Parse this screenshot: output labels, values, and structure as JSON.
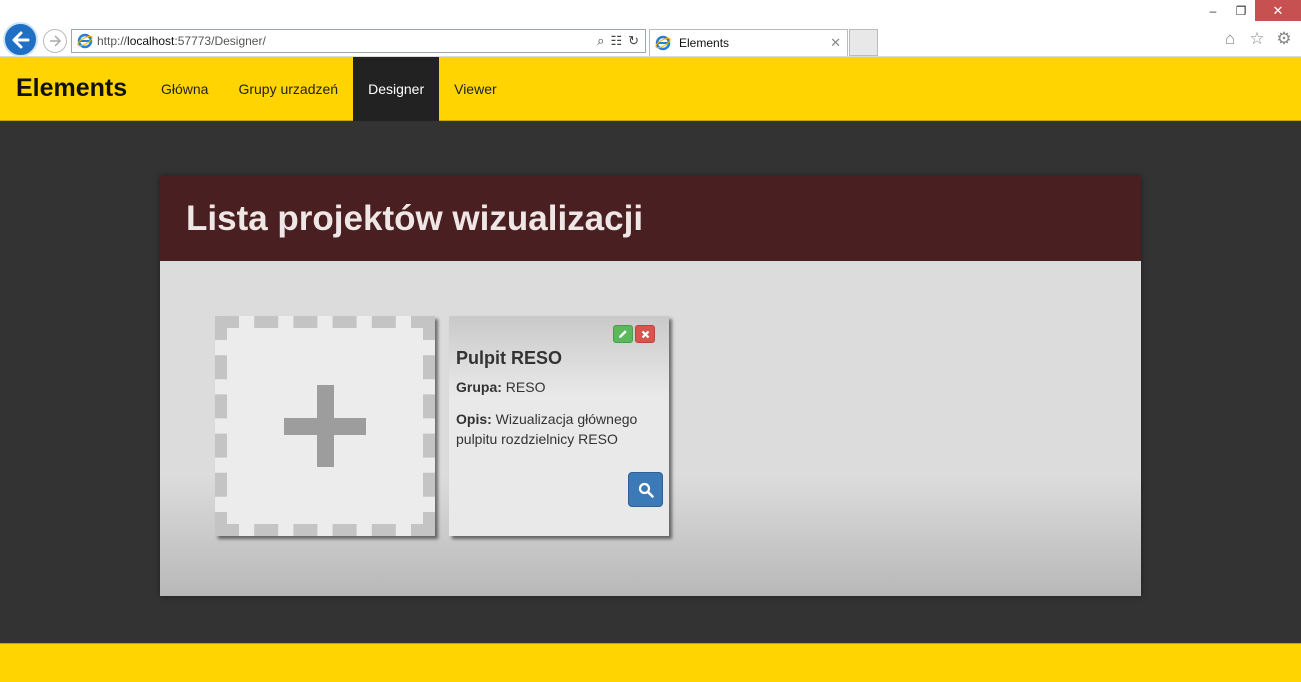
{
  "browser": {
    "url_prefix": "http://",
    "url_host": "localhost",
    "url_rest": ":57773/Designer/",
    "tab_title": "Elements",
    "window_controls": {
      "minimize": "–",
      "restore": "❐",
      "close": "✕"
    },
    "icons": [
      "home-icon",
      "favorites-star-icon",
      "settings-gear-icon"
    ]
  },
  "navbar": {
    "brand": "Elements",
    "items": [
      {
        "label": "Główna",
        "active": false
      },
      {
        "label": "Grupy urzadzeń",
        "active": false
      },
      {
        "label": "Designer",
        "active": true
      },
      {
        "label": "Viewer",
        "active": false
      }
    ]
  },
  "panel": {
    "title": "Lista projektów wizualizacji"
  },
  "project_card": {
    "title": "Pulpit RESO",
    "group_label": "Grupa:",
    "group_value": "RESO",
    "desc_label": "Opis:",
    "desc_value": "Wizualizacja głównego pulpitu rozdzielnicy RESO"
  },
  "colors": {
    "navbar": "#ffd400",
    "panel_header": "#4a1f21",
    "edit_button": "#5cb85c",
    "delete_button": "#d9534f",
    "view_button": "#3b79b7"
  }
}
